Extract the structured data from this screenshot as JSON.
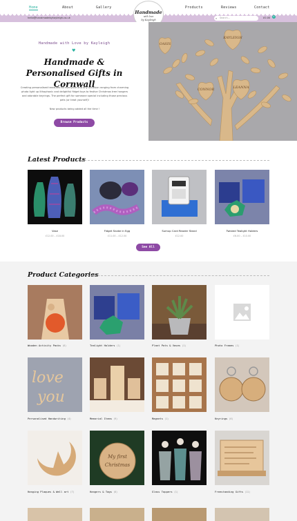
{
  "nav": {
    "items": [
      "Home",
      "About",
      "Gallery",
      "Products",
      "Reviews",
      "Contact"
    ]
  },
  "logo": {
    "line1": "Handmade",
    "line2": "with love",
    "line3": "by Kayleigh"
  },
  "topbar": {
    "email": "hello@handmadebykayleigh.co.uk",
    "search_placeholder": "Search...",
    "cart_total": "£0.00",
    "cart_count": "0"
  },
  "hero": {
    "tagline": "Handmade with Love by Kayleigh",
    "title": "Handmade & Personalised Gifts in Cornwall",
    "description": "Creating personalised treasures for everyone and any occasion ranging from charming photo light up lithophanic and delightful fidget toys to festive Christmas tree hangers and adorable keyrings. The perfect gift for someone special including those precious pets (or treat yourself)!",
    "note": "New products being added all the time !",
    "button": "Browse Products",
    "tree_tags": [
      "OASIS",
      "KAYLEIGH",
      "CONNOR",
      "LEANNA"
    ]
  },
  "latest": {
    "title": "Latest Products",
    "products": [
      {
        "name": "Vase",
        "price": "£12.00 – £18.00"
      },
      {
        "name": "Fidget Snake in Egg",
        "price": "£11.00 – £12.00"
      },
      {
        "name": "Sumup Card Reader Stand",
        "price": "£12.00"
      },
      {
        "name": "Twisted Tealight Holders",
        "price": "£6.00 – £10.00"
      }
    ],
    "button": "See All"
  },
  "categories": {
    "title": "Product Categories",
    "items": [
      {
        "name": "Wooden Activity Packs",
        "count": "(6)"
      },
      {
        "name": "Tealight Holders",
        "count": "(1)"
      },
      {
        "name": "Plant Pots & Vases",
        "count": "(1)"
      },
      {
        "name": "Photo Frames",
        "count": "(1)"
      },
      {
        "name": "Personalised Handwriting",
        "count": "(4)"
      },
      {
        "name": "Memorial Items",
        "count": "(9)"
      },
      {
        "name": "Magnets",
        "count": "(1)"
      },
      {
        "name": "Keyrings",
        "count": "(6)"
      },
      {
        "name": "Hanging Plaques & Wall art",
        "count": "(7)"
      },
      {
        "name": "Hangers & Tags",
        "count": "(6)"
      },
      {
        "name": "Glass Toppers",
        "count": "(1)"
      },
      {
        "name": "Freestanding Gifts",
        "count": "(11)"
      }
    ]
  },
  "colors": {
    "accent": "#8e4aa5",
    "teal": "#2bb3a0",
    "lavender": "#d7c0dd"
  }
}
